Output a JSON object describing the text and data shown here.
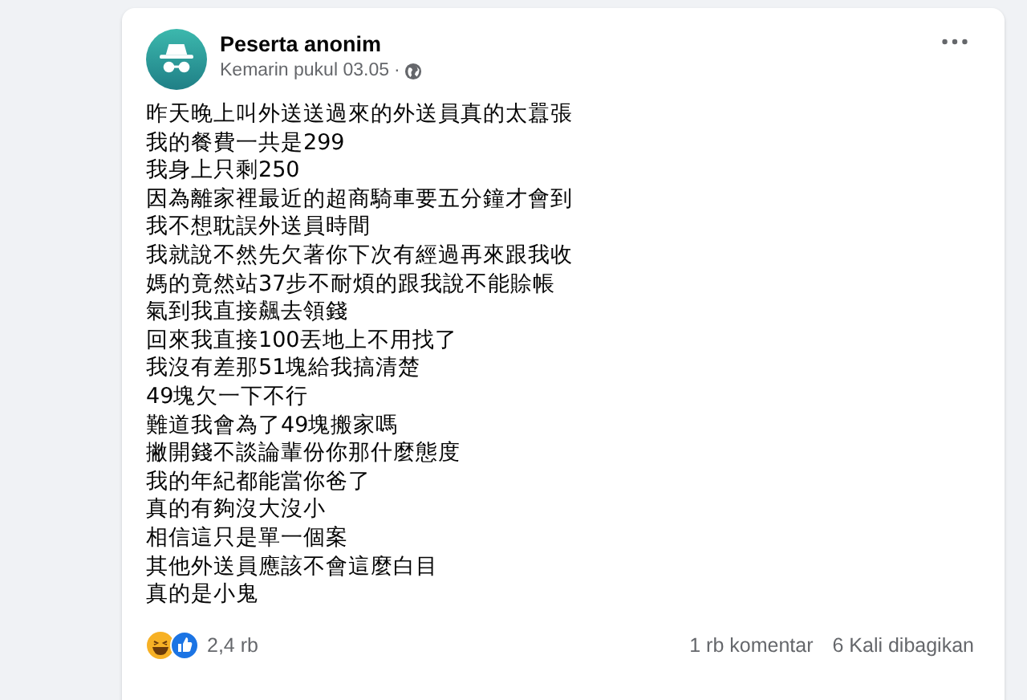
{
  "post": {
    "author": "Peserta anonim",
    "timestamp": "Kemarin pukul 03.05",
    "separator": "·",
    "lines": [
      "昨天晚上叫外送送過來的外送員真的太囂張",
      "我的餐費一共是299",
      "我身上只剩250",
      "因為離家裡最近的超商騎車要五分鐘才會到",
      "我不想耽誤外送員時間",
      "我就說不然先欠著你下次有經過再來跟我收",
      "媽的竟然站37步不耐煩的跟我說不能賒帳",
      "氣到我直接飆去領錢",
      "回來我直接100丟地上不用找了",
      "我沒有差那51塊給我搞清楚",
      "49塊欠一下不行",
      "難道我會為了49塊搬家嗎",
      "撇開錢不談論輩份你那什麼態度",
      "我的年紀都能當你爸了",
      "真的有夠沒大沒小",
      "相信這只是單一個案",
      "其他外送員應該不會這麼白目",
      "真的是小鬼"
    ],
    "reactions_count": "2,4 rb",
    "comments": "1 rb komentar",
    "shares": "6 Kali dibagikan"
  }
}
